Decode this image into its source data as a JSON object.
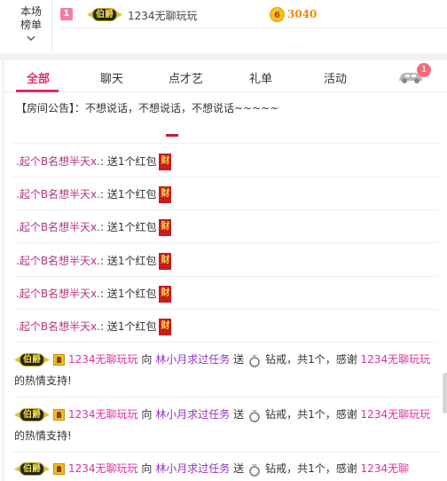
{
  "ranking": {
    "tab_label_line1": "本场",
    "tab_label_line2": "榜单",
    "entry": {
      "rank": "1",
      "badge": "伯爵",
      "name": "1234无聊玩玩",
      "coin_glyph": "6",
      "value": "3040"
    }
  },
  "tabs": [
    {
      "label": "全部",
      "active": true
    },
    {
      "label": "聊天"
    },
    {
      "label": "点才艺"
    },
    {
      "label": "礼单"
    },
    {
      "label": "活动"
    }
  ],
  "car_badge_count": "1",
  "announcement": "【房间公告】：不想说话，不想说话，不想说话~~~~~",
  "gift_rows": [
    {
      "sender": ".起个B名想半天x.",
      "text": ": 送1个红包",
      "icon_text": "财"
    },
    {
      "sender": ".起个B名想半天x.",
      "text": ": 送1个红包",
      "icon_text": "财"
    },
    {
      "sender": ".起个B名想半天x.",
      "text": ": 送1个红包",
      "icon_text": "财"
    },
    {
      "sender": ".起个B名想半天x.",
      "text": ": 送1个红包",
      "icon_text": "财"
    },
    {
      "sender": ".起个B名想半天x.",
      "text": ": 送1个红包",
      "icon_text": "财"
    },
    {
      "sender": ".起个B名想半天x.",
      "text": ": 送1个红包",
      "icon_text": "财"
    }
  ],
  "thanks_rows": [
    {
      "badge": "伯爵",
      "sender": "1234无聊玩玩",
      "to": "向",
      "target": "林小月求过任务",
      "send": "送",
      "gift": "钻戒，共1个，感谢",
      "sender2": "1234无聊玩玩",
      "tail": "的热情支持!"
    },
    {
      "badge": "伯爵",
      "sender": "1234无聊玩玩",
      "to": "向",
      "target": "林小月求过任务",
      "send": "送",
      "gift": "钻戒，共1个，感谢",
      "sender2": "1234无聊玩玩",
      "tail": "的热情支持!"
    },
    {
      "badge": "伯爵",
      "sender": "1234无聊玩玩",
      "to": "向",
      "target": "林小月求过任务",
      "send": "送",
      "gift": "钻戒，共1个，感谢",
      "sender2": "1234无聊",
      "tail": ""
    }
  ]
}
